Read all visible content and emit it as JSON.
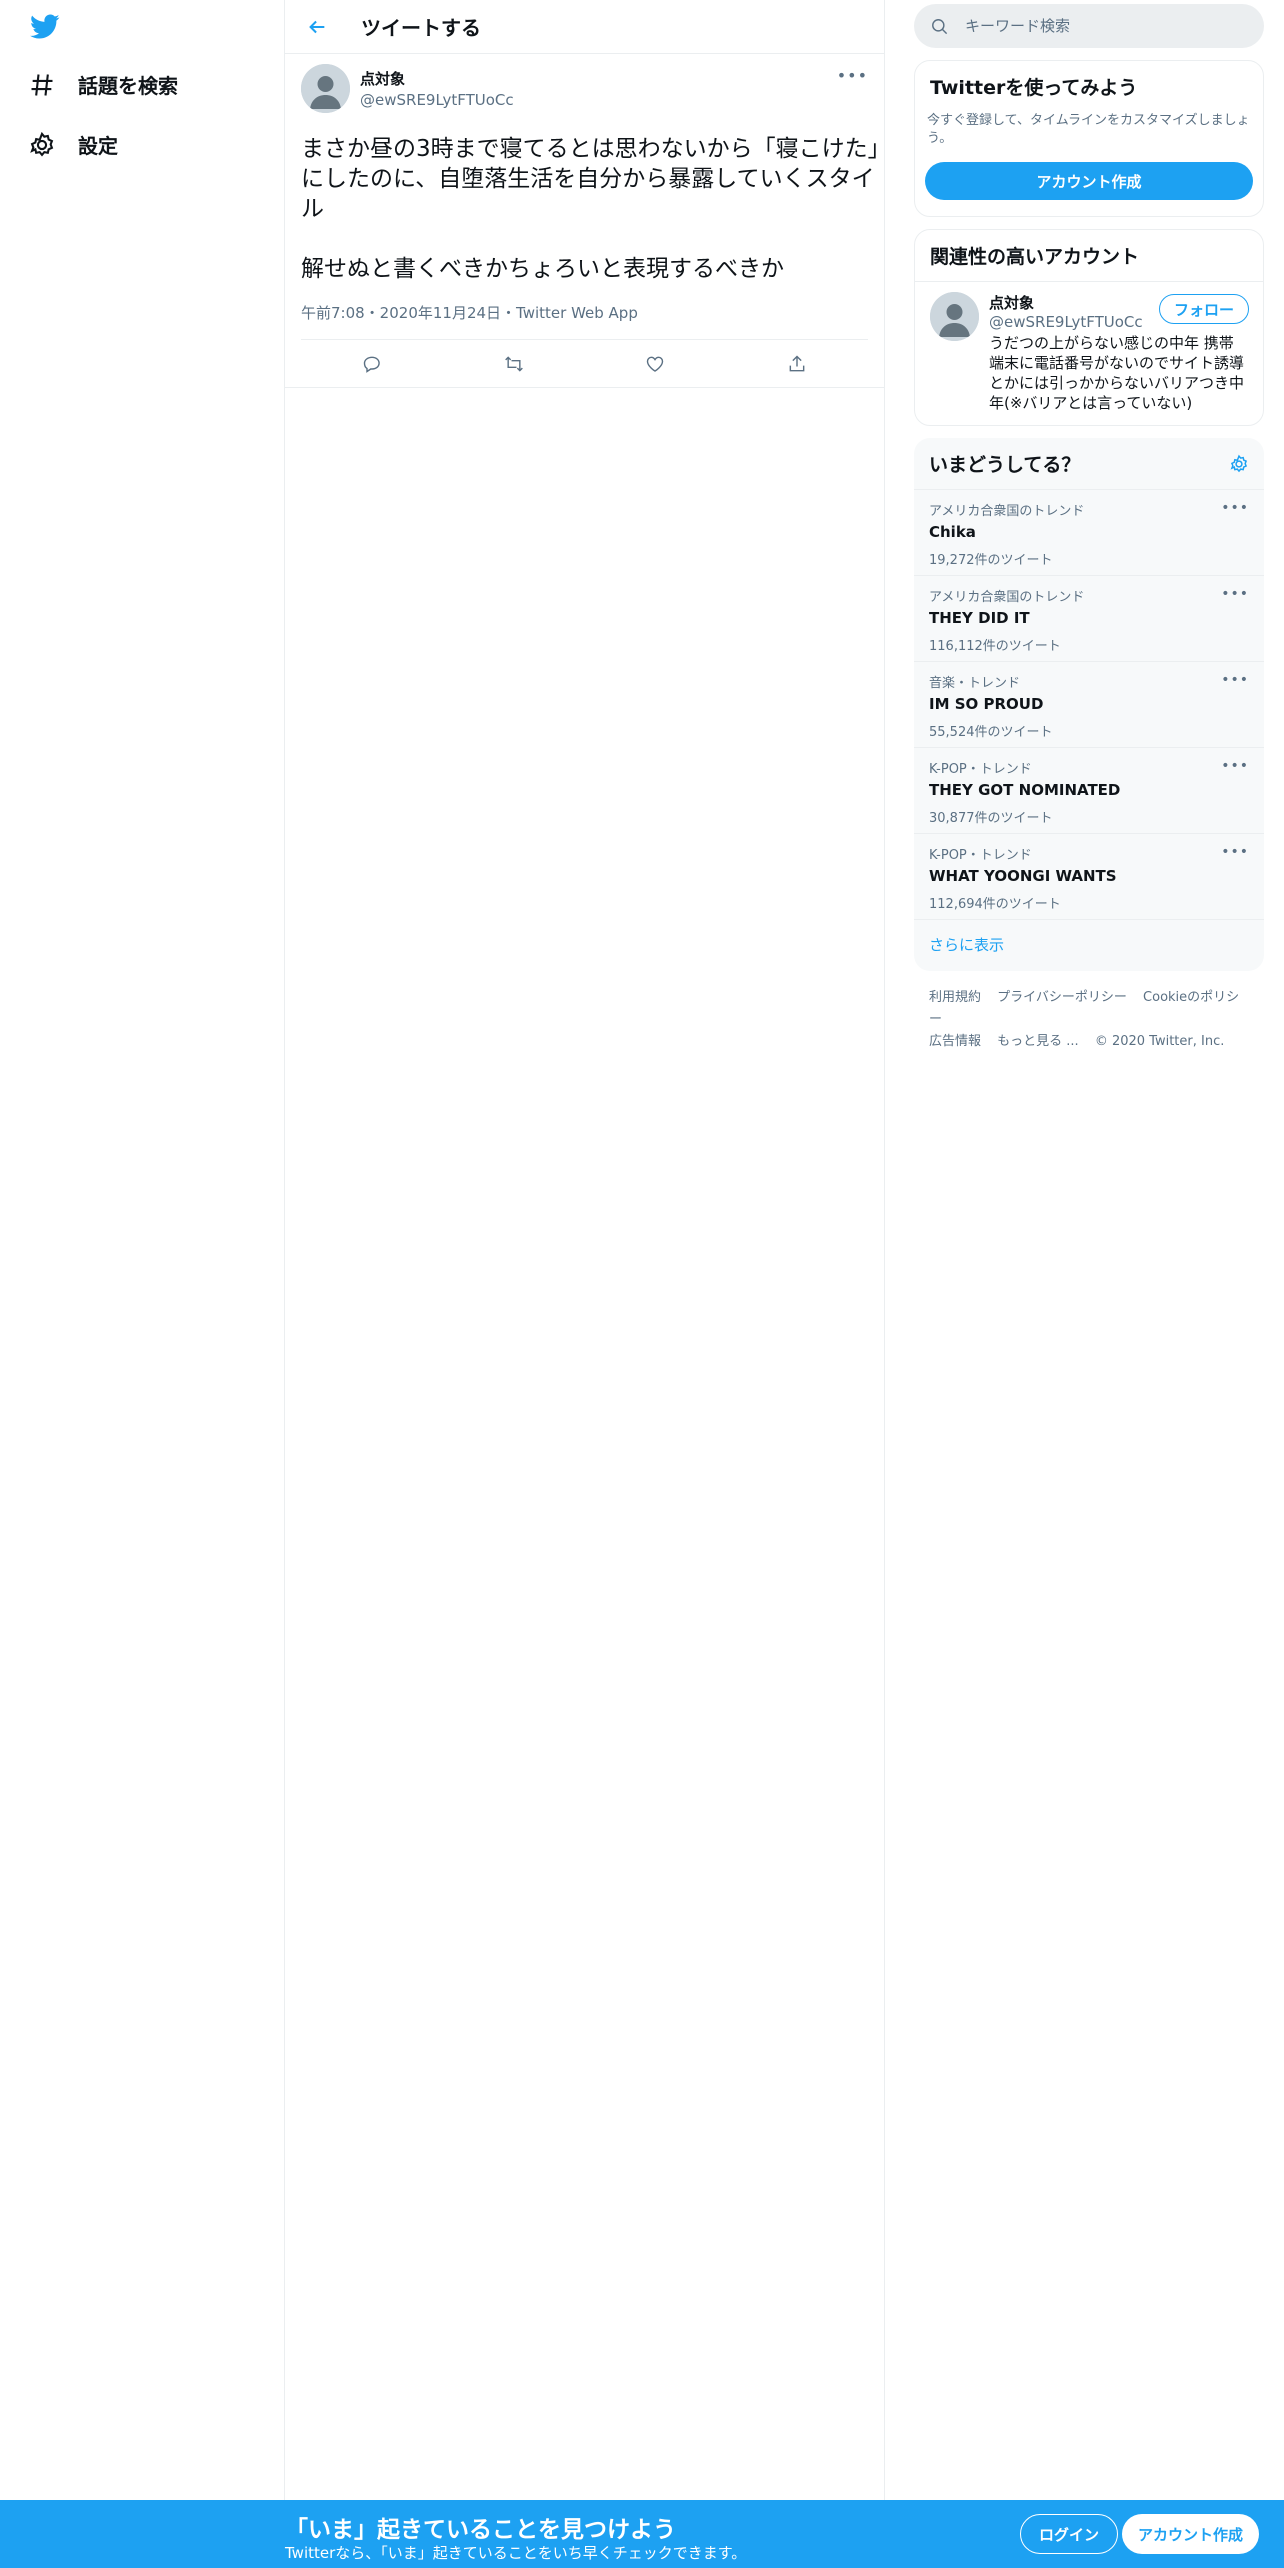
{
  "nav": {
    "explore_label": "話題を検索",
    "settings_label": "設定"
  },
  "header": {
    "title": "ツイートする"
  },
  "tweet": {
    "name": "点対象",
    "handle": "@ewSRE9LytFTUoCc",
    "more": "•••",
    "text": "まさか昼の3時まで寝てるとは思わないから「寝こけた」にしたのに、自堕落生活を自分から暴露していくスタイル\n\n解せぬと書くべきかちょろいと表現するべきか",
    "time": "午前7:08・2020年11月24日・Twitter Web App"
  },
  "search": {
    "placeholder": "キーワード検索"
  },
  "signup_card": {
    "title": "Twitterを使ってみよう",
    "sub": "今すぐ登録して、タイムラインをカスタマイズしましょう。",
    "button": "アカウント作成"
  },
  "related": {
    "title": "関連性の高いアカウント",
    "name": "点対象",
    "handle": "@ewSRE9LytFTUoCc",
    "follow": "フォロー",
    "bio": "うだつの上がらない感じの中年 携帯端末に電話番号がないのでサイト誘導とかには引っかからないバリアつき中年(※バリアとは言っていない)"
  },
  "trends": {
    "title": "いまどうしてる？",
    "more_icon": "•••",
    "items": [
      {
        "context": "アメリカ合衆国のトレンド",
        "name": "Chika",
        "count": "19,272件のツイート"
      },
      {
        "context": "アメリカ合衆国のトレンド",
        "name": "THEY DID IT",
        "count": "116,112件のツイート"
      },
      {
        "context": "音楽・トレンド",
        "name": "IM SO PROUD",
        "count": "55,524件のツイート"
      },
      {
        "context": "K-POP・トレンド",
        "name": "THEY GOT NOMINATED",
        "count": "30,877件のツイート"
      },
      {
        "context": "K-POP・トレンド",
        "name": "WHAT YOONGI WANTS",
        "count": "112,694件のツイート"
      }
    ],
    "show_more": "さらに表示"
  },
  "footer": {
    "terms": "利用規約",
    "privacy": "プライバシーポリシー",
    "cookie": "Cookieのポリシー",
    "ads": "広告情報",
    "more": "もっと見る ...",
    "copyright": "© 2020 Twitter, Inc."
  },
  "bottom_bar": {
    "title": "「いま」起きていることを見つけよう",
    "sub": "Twitterなら、「いま」起きていることをいち早くチェックできます。",
    "login": "ログイン",
    "signup": "アカウント作成"
  },
  "colors": {
    "accent": "#1da1f2",
    "muted": "#5b7083",
    "border": "#ebeef0"
  }
}
